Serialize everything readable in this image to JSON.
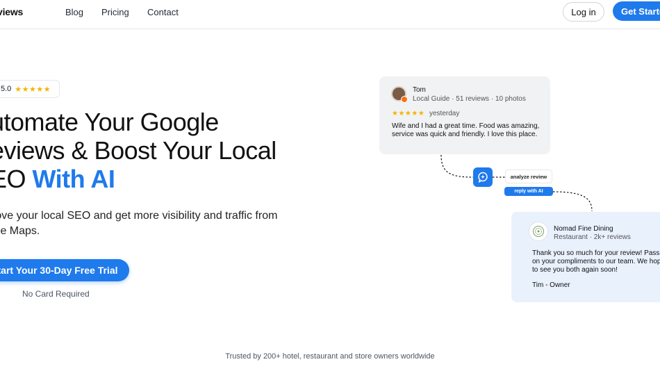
{
  "header": {
    "brand": "views",
    "nav": [
      "Blog",
      "Pricing",
      "Contact"
    ],
    "login": "Log in",
    "get_started": "Get Started"
  },
  "hero": {
    "rating_value": "5.0",
    "rating_stars": "★★★★★",
    "headline_line1": "utomate Your Google",
    "headline_line2": "eviews & Boost Your Local",
    "headline_line3_prefix": "EO ",
    "headline_accent": "With AI",
    "subtext_line1": "rove your local SEO and get more visibility and traffic from",
    "subtext_line2": "gle Maps.",
    "cta": "tart Your 30-Day Free Trial",
    "no_card": "No Card Required"
  },
  "review": {
    "name": "Tom",
    "meta": "Local Guide · 51 reviews · 10 photos",
    "stars": "★★★★★",
    "date": "yesterday",
    "text": "Wife and I had a great time. Food was amazing, service was quick and friendly. I love this place."
  },
  "flow": {
    "analyze": "analyze review",
    "reply": "reply with AI"
  },
  "reply": {
    "business_name": "Nomad Fine Dining",
    "business_meta": "Restaurant · 2k+ reviews",
    "line1": "Thank you so much for your review! Passin",
    "line2": "on your compliments to our team. We hope",
    "line3": "to see you both again soon!",
    "signature": "Tim - Owner"
  },
  "footer": {
    "trusted": "Trusted by 200+ hotel, restaurant and store owners worldwide"
  },
  "colors": {
    "accent": "#1f7aec",
    "star": "#f5b301"
  }
}
